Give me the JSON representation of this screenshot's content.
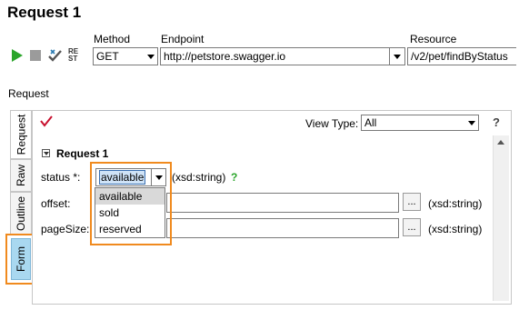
{
  "window": {
    "title": "Request 1"
  },
  "toolbar": {
    "run_icon": "play-icon",
    "stop_icon": "stop-icon",
    "reset_label_top": "RE",
    "reset_label_bottom": "ST"
  },
  "request_bar": {
    "method_label": "Method",
    "method_value": "GET",
    "endpoint_label": "Endpoint",
    "endpoint_value": "http://petstore.swagger.io",
    "resource_label": "Resource",
    "resource_value": "/v2/pet/findByStatus"
  },
  "section_label": "Request",
  "side_tabs": [
    "Request",
    "Raw",
    "Outline",
    "Form"
  ],
  "form": {
    "view_type_label": "View Type:",
    "view_type_value": "All",
    "help_label": "?",
    "group_title": "Request 1",
    "fields": {
      "status": {
        "label": "status *:",
        "value": "available",
        "type": "(xsd:string)",
        "hint": "?"
      },
      "offset": {
        "label": "offset:",
        "value": "",
        "type": "(xsd:string)",
        "browse": "..."
      },
      "pageSize": {
        "label": "pageSize:",
        "value": "",
        "type": "(xsd:string)",
        "browse": "..."
      }
    },
    "status_options": [
      "available",
      "sold",
      "reserved"
    ]
  },
  "colors": {
    "highlight": "#f08a1e",
    "run_green": "#2aa52a",
    "check_red": "#c8102e",
    "hint_green": "#2aa52a"
  }
}
